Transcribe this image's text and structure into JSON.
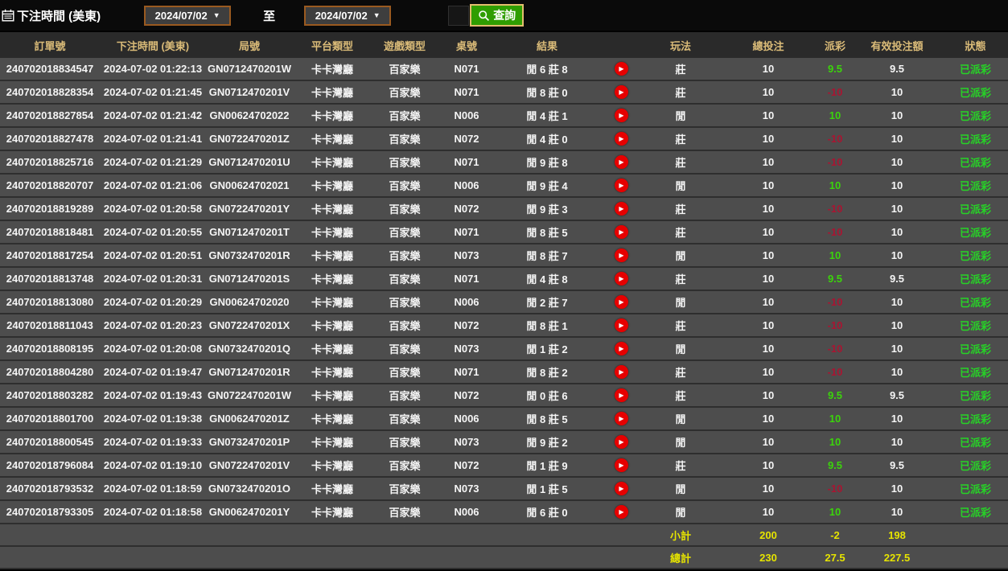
{
  "filter": {
    "title": "下注時間 (美東)",
    "date_from": "2024/07/02",
    "to_label": "至",
    "date_to": "2024/07/02",
    "query_label": "查詢"
  },
  "table": {
    "headers": [
      "訂單號",
      "下注時間 (美東)",
      "局號",
      "平台類型",
      "遊戲類型",
      "桌號",
      "結果",
      "玩法",
      "總投注",
      "派彩",
      "有效投注額",
      "狀態"
    ],
    "rows": [
      {
        "order_no": "240702018834547",
        "bet_time": "2024-07-02 01:22:13",
        "round_no": "GN0712470201W",
        "platform": "卡卡灣廳",
        "game_type": "百家樂",
        "table_no": "N071",
        "result": "閒 6 莊 8",
        "play": "莊",
        "total_bet": "10",
        "payout": "9.5",
        "valid_bet": "9.5",
        "status": "已派彩"
      },
      {
        "order_no": "240702018828354",
        "bet_time": "2024-07-02 01:21:45",
        "round_no": "GN0712470201V",
        "platform": "卡卡灣廳",
        "game_type": "百家樂",
        "table_no": "N071",
        "result": "閒 8 莊 0",
        "play": "莊",
        "total_bet": "10",
        "payout": "-10",
        "valid_bet": "10",
        "status": "已派彩"
      },
      {
        "order_no": "240702018827854",
        "bet_time": "2024-07-02 01:21:42",
        "round_no": "GN00624702022",
        "platform": "卡卡灣廳",
        "game_type": "百家樂",
        "table_no": "N006",
        "result": "閒 4 莊 1",
        "play": "閒",
        "total_bet": "10",
        "payout": "10",
        "valid_bet": "10",
        "status": "已派彩"
      },
      {
        "order_no": "240702018827478",
        "bet_time": "2024-07-02 01:21:41",
        "round_no": "GN0722470201Z",
        "platform": "卡卡灣廳",
        "game_type": "百家樂",
        "table_no": "N072",
        "result": "閒 4 莊 0",
        "play": "莊",
        "total_bet": "10",
        "payout": "-10",
        "valid_bet": "10",
        "status": "已派彩"
      },
      {
        "order_no": "240702018825716",
        "bet_time": "2024-07-02 01:21:29",
        "round_no": "GN0712470201U",
        "platform": "卡卡灣廳",
        "game_type": "百家樂",
        "table_no": "N071",
        "result": "閒 9 莊 8",
        "play": "莊",
        "total_bet": "10",
        "payout": "-10",
        "valid_bet": "10",
        "status": "已派彩"
      },
      {
        "order_no": "240702018820707",
        "bet_time": "2024-07-02 01:21:06",
        "round_no": "GN00624702021",
        "platform": "卡卡灣廳",
        "game_type": "百家樂",
        "table_no": "N006",
        "result": "閒 9 莊 4",
        "play": "閒",
        "total_bet": "10",
        "payout": "10",
        "valid_bet": "10",
        "status": "已派彩"
      },
      {
        "order_no": "240702018819289",
        "bet_time": "2024-07-02 01:20:58",
        "round_no": "GN0722470201Y",
        "platform": "卡卡灣廳",
        "game_type": "百家樂",
        "table_no": "N072",
        "result": "閒 9 莊 3",
        "play": "莊",
        "total_bet": "10",
        "payout": "-10",
        "valid_bet": "10",
        "status": "已派彩"
      },
      {
        "order_no": "240702018818481",
        "bet_time": "2024-07-02 01:20:55",
        "round_no": "GN0712470201T",
        "platform": "卡卡灣廳",
        "game_type": "百家樂",
        "table_no": "N071",
        "result": "閒 8 莊 5",
        "play": "莊",
        "total_bet": "10",
        "payout": "-10",
        "valid_bet": "10",
        "status": "已派彩"
      },
      {
        "order_no": "240702018817254",
        "bet_time": "2024-07-02 01:20:51",
        "round_no": "GN0732470201R",
        "platform": "卡卡灣廳",
        "game_type": "百家樂",
        "table_no": "N073",
        "result": "閒 8 莊 7",
        "play": "閒",
        "total_bet": "10",
        "payout": "10",
        "valid_bet": "10",
        "status": "已派彩"
      },
      {
        "order_no": "240702018813748",
        "bet_time": "2024-07-02 01:20:31",
        "round_no": "GN0712470201S",
        "platform": "卡卡灣廳",
        "game_type": "百家樂",
        "table_no": "N071",
        "result": "閒 4 莊 8",
        "play": "莊",
        "total_bet": "10",
        "payout": "9.5",
        "valid_bet": "9.5",
        "status": "已派彩"
      },
      {
        "order_no": "240702018813080",
        "bet_time": "2024-07-02 01:20:29",
        "round_no": "GN00624702020",
        "platform": "卡卡灣廳",
        "game_type": "百家樂",
        "table_no": "N006",
        "result": "閒 2 莊 7",
        "play": "閒",
        "total_bet": "10",
        "payout": "-10",
        "valid_bet": "10",
        "status": "已派彩"
      },
      {
        "order_no": "240702018811043",
        "bet_time": "2024-07-02 01:20:23",
        "round_no": "GN0722470201X",
        "platform": "卡卡灣廳",
        "game_type": "百家樂",
        "table_no": "N072",
        "result": "閒 8 莊 1",
        "play": "莊",
        "total_bet": "10",
        "payout": "-10",
        "valid_bet": "10",
        "status": "已派彩"
      },
      {
        "order_no": "240702018808195",
        "bet_time": "2024-07-02 01:20:08",
        "round_no": "GN0732470201Q",
        "platform": "卡卡灣廳",
        "game_type": "百家樂",
        "table_no": "N073",
        "result": "閒 1 莊 2",
        "play": "閒",
        "total_bet": "10",
        "payout": "-10",
        "valid_bet": "10",
        "status": "已派彩"
      },
      {
        "order_no": "240702018804280",
        "bet_time": "2024-07-02 01:19:47",
        "round_no": "GN0712470201R",
        "platform": "卡卡灣廳",
        "game_type": "百家樂",
        "table_no": "N071",
        "result": "閒 8 莊 2",
        "play": "莊",
        "total_bet": "10",
        "payout": "-10",
        "valid_bet": "10",
        "status": "已派彩"
      },
      {
        "order_no": "240702018803282",
        "bet_time": "2024-07-02 01:19:43",
        "round_no": "GN0722470201W",
        "platform": "卡卡灣廳",
        "game_type": "百家樂",
        "table_no": "N072",
        "result": "閒 0 莊 6",
        "play": "莊",
        "total_bet": "10",
        "payout": "9.5",
        "valid_bet": "9.5",
        "status": "已派彩"
      },
      {
        "order_no": "240702018801700",
        "bet_time": "2024-07-02 01:19:38",
        "round_no": "GN0062470201Z",
        "platform": "卡卡灣廳",
        "game_type": "百家樂",
        "table_no": "N006",
        "result": "閒 8 莊 5",
        "play": "閒",
        "total_bet": "10",
        "payout": "10",
        "valid_bet": "10",
        "status": "已派彩"
      },
      {
        "order_no": "240702018800545",
        "bet_time": "2024-07-02 01:19:33",
        "round_no": "GN0732470201P",
        "platform": "卡卡灣廳",
        "game_type": "百家樂",
        "table_no": "N073",
        "result": "閒 9 莊 2",
        "play": "閒",
        "total_bet": "10",
        "payout": "10",
        "valid_bet": "10",
        "status": "已派彩"
      },
      {
        "order_no": "240702018796084",
        "bet_time": "2024-07-02 01:19:10",
        "round_no": "GN0722470201V",
        "platform": "卡卡灣廳",
        "game_type": "百家樂",
        "table_no": "N072",
        "result": "閒 1 莊 9",
        "play": "莊",
        "total_bet": "10",
        "payout": "9.5",
        "valid_bet": "9.5",
        "status": "已派彩"
      },
      {
        "order_no": "240702018793532",
        "bet_time": "2024-07-02 01:18:59",
        "round_no": "GN0732470201O",
        "platform": "卡卡灣廳",
        "game_type": "百家樂",
        "table_no": "N073",
        "result": "閒 1 莊 5",
        "play": "閒",
        "total_bet": "10",
        "payout": "-10",
        "valid_bet": "10",
        "status": "已派彩"
      },
      {
        "order_no": "240702018793305",
        "bet_time": "2024-07-02 01:18:58",
        "round_no": "GN0062470201Y",
        "platform": "卡卡灣廳",
        "game_type": "百家樂",
        "table_no": "N006",
        "result": "閒 6 莊 0",
        "play": "閒",
        "total_bet": "10",
        "payout": "10",
        "valid_bet": "10",
        "status": "已派彩"
      }
    ],
    "subtotal": {
      "label": "小計",
      "total_bet": "200",
      "payout": "-2",
      "valid_bet": "198"
    },
    "grand_total": {
      "label": "總計",
      "total_bet": "230",
      "payout": "27.5",
      "valid_bet": "227.5"
    }
  },
  "colors": {
    "query_button_green": "#2f9d01",
    "payout_positive_green": "#3bd40b",
    "payout_negative_red": "#aa1431",
    "status_green": "#27d227",
    "summary_yellow": "#e6e400",
    "header_gold": "#dabb78",
    "date_border_orange": "#9a5a20",
    "play_icon_red": "#e60000"
  }
}
